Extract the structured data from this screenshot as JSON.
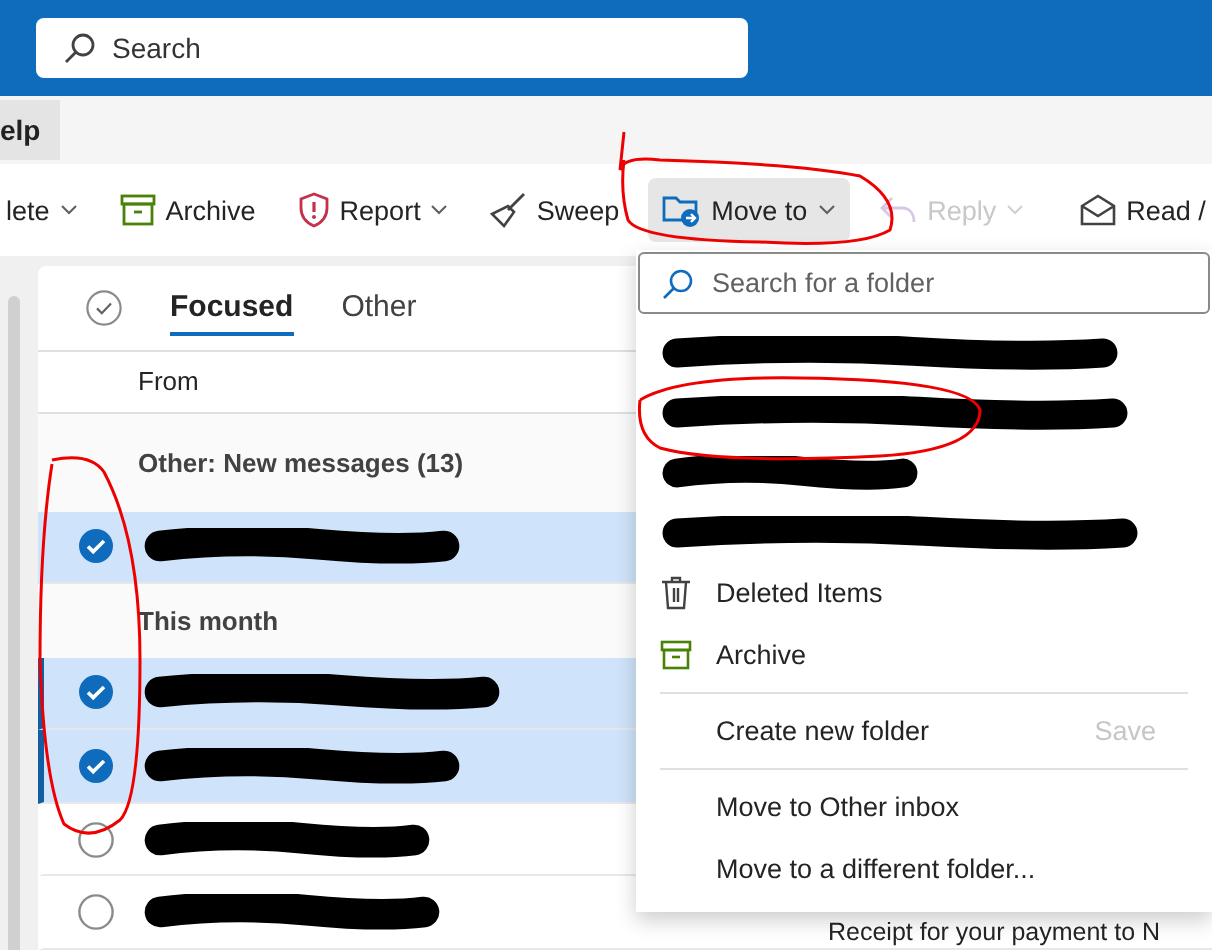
{
  "search": {
    "placeholder": "Search"
  },
  "ribbon_tabs": [
    {
      "label": "elp",
      "selected": true
    }
  ],
  "toolbar": [
    {
      "kind": "delete",
      "label": "lete",
      "disabled": false,
      "caret": true
    },
    {
      "kind": "archive",
      "label": "Archive",
      "disabled": false,
      "caret": false
    },
    {
      "kind": "report",
      "label": "Report",
      "disabled": false,
      "caret": true
    },
    {
      "kind": "sweep",
      "label": "Sweep",
      "disabled": false,
      "caret": false
    },
    {
      "kind": "move",
      "label": "Move to",
      "disabled": false,
      "caret": true,
      "pressed": true
    },
    {
      "kind": "reply",
      "label": "Reply",
      "disabled": true,
      "caret": true
    },
    {
      "kind": "read",
      "label": "Read /",
      "disabled": false,
      "caret": false
    }
  ],
  "mail_list": {
    "tabs": [
      {
        "label": "Focused",
        "selected": true
      },
      {
        "label": "Other",
        "selected": false
      }
    ],
    "sort_label": "From",
    "groups": [
      {
        "title": "Other: New messages (13)",
        "rows": [
          {
            "selected": true,
            "accent_bar": false
          }
        ]
      },
      {
        "title": "This month",
        "rows": [
          {
            "selected": true,
            "accent_bar": true
          },
          {
            "selected": true,
            "accent_bar": true
          },
          {
            "selected": false,
            "accent_bar": false
          },
          {
            "selected": false,
            "accent_bar": false,
            "preview": "Receipt for your payment to N"
          }
        ]
      }
    ]
  },
  "move_menu": {
    "search": {
      "placeholder": "Search for a folder"
    },
    "folders": [
      {
        "kind": "redacted"
      },
      {
        "kind": "redacted"
      },
      {
        "kind": "redacted"
      },
      {
        "kind": "redacted"
      },
      {
        "kind": "trash",
        "label": "Deleted Items"
      },
      {
        "kind": "archive",
        "label": "Archive"
      }
    ],
    "create": {
      "label": "Create new folder",
      "save": "Save",
      "save_disabled": true
    },
    "actions": [
      "Move to Other inbox",
      "Move to a different folder..."
    ]
  }
}
